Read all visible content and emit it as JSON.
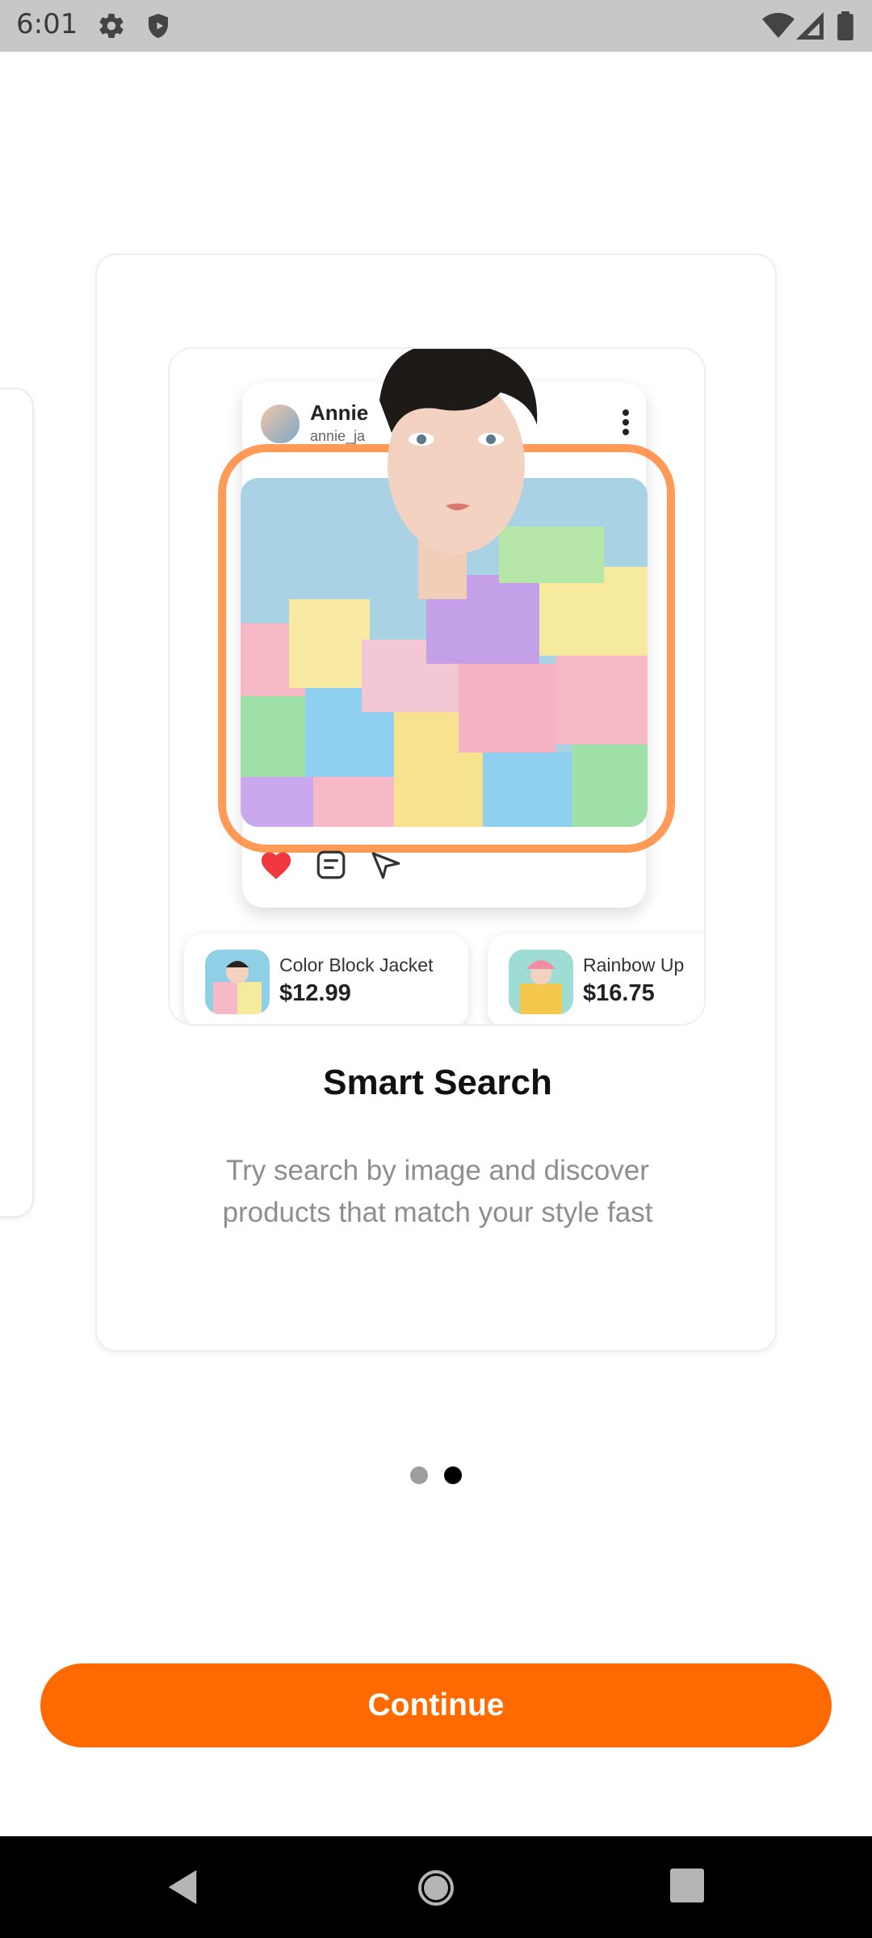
{
  "status_bar": {
    "time": "6:01",
    "left_icons": [
      "gear-icon",
      "shield-icon"
    ],
    "right_icons": [
      "wifi-icon",
      "signal-icon",
      "battery-icon"
    ]
  },
  "illustration": {
    "post_name": "Annie",
    "post_handle": "annie_ja",
    "products": [
      {
        "name": "Color Block Jacket",
        "price": "$12.99"
      },
      {
        "name": "Rainbow Up",
        "price": "$16.75"
      }
    ],
    "action_icons": [
      "heart-icon",
      "comment-icon",
      "share-icon"
    ]
  },
  "card": {
    "title": "Smart Search",
    "description": "Try search by image and discover products that match your style fast"
  },
  "pagination": {
    "total": 2,
    "active_index": 1
  },
  "cta": {
    "label": "Continue"
  },
  "colors": {
    "accent": "#ff6a00",
    "frame": "#ff8a3a",
    "dot_inactive": "#9e9e9e",
    "dot_active": "#000000"
  },
  "nav_bar": {
    "buttons": [
      "back-icon",
      "home-icon",
      "recents-icon"
    ]
  }
}
